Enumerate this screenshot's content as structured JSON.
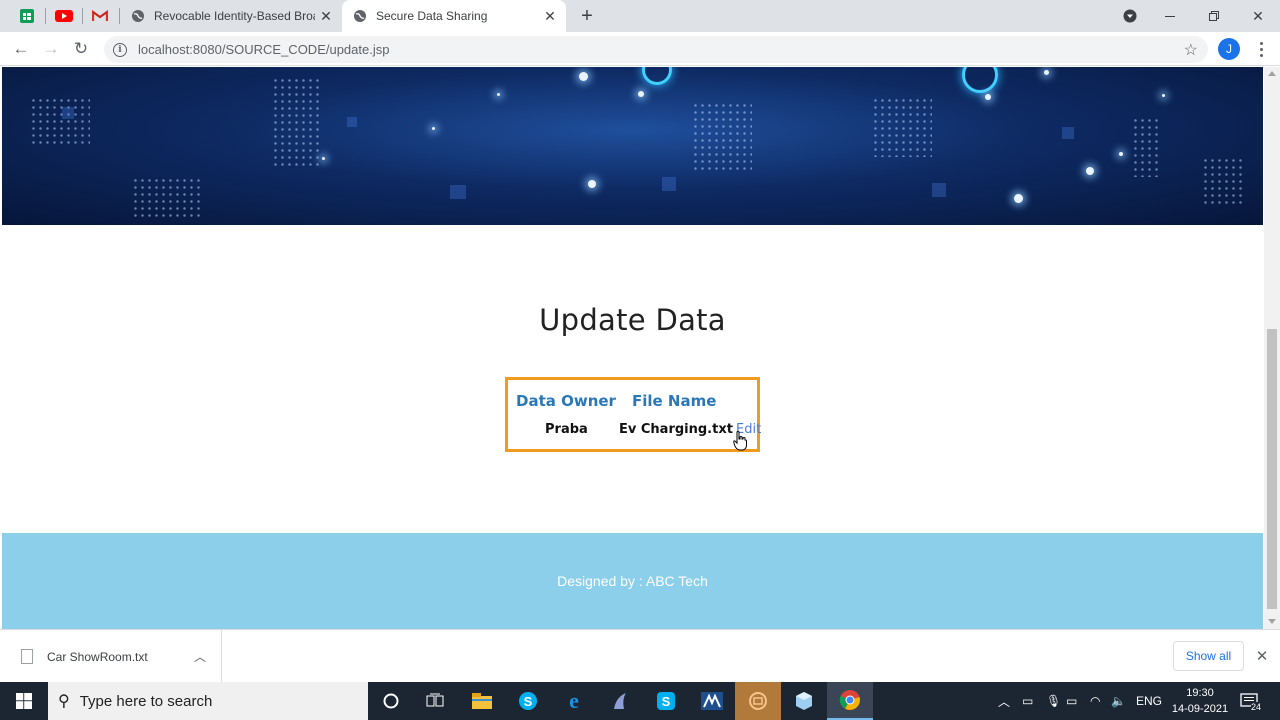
{
  "browser": {
    "tabs": [
      {
        "title": "Revocable Identity-Based Broadc",
        "active": false
      },
      {
        "title": "Secure Data Sharing",
        "active": true
      }
    ],
    "url": "localhost:8080/SOURCE_CODE/update.jsp",
    "profile_initial": "J"
  },
  "page": {
    "heading": "Update Data",
    "table": {
      "headers": [
        "Data Owner",
        "File Name"
      ],
      "rows": [
        {
          "owner": "Praba",
          "file": "Ev Charging.txt",
          "action": "Edit"
        }
      ]
    },
    "footer_text": "Designed by : ABC Tech"
  },
  "downloads": {
    "file_name": "Car ShowRoom.txt",
    "show_all_label": "Show all"
  },
  "taskbar": {
    "search_placeholder": "Type here to search",
    "language": "ENG",
    "time": "19:30",
    "date": "14-09-2021",
    "notification_count": "24"
  },
  "colors": {
    "accent_border": "#f29a1b",
    "header_text": "#2a78b8",
    "footer_bg": "#8ccfea",
    "link": "#4a7fd6"
  }
}
